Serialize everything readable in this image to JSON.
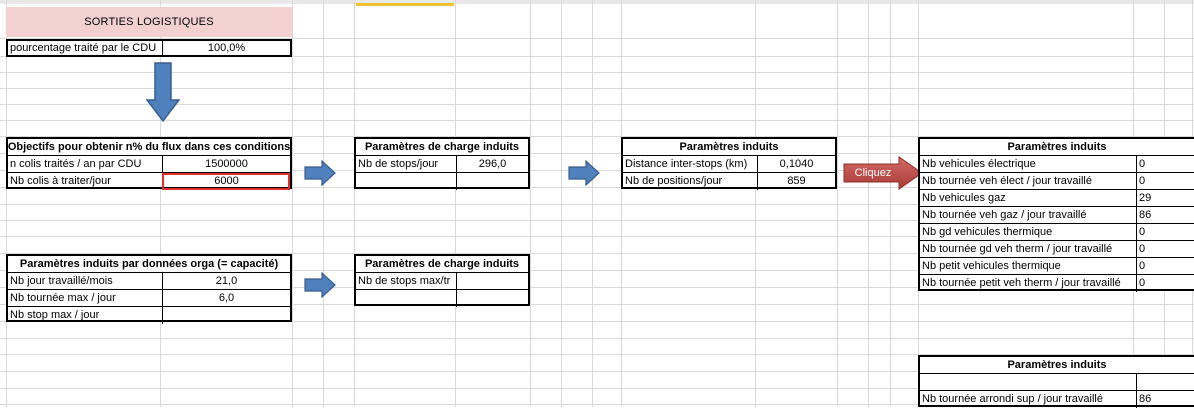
{
  "colors": {
    "title_fill": "#f3d1d1",
    "arrow_blue": "#4f81bd",
    "button_red": "#c0504d",
    "highlight_border": "#e03030"
  },
  "title": "SORTIES LOGISTIQUES",
  "percentage": {
    "label": "pourcentage traité par le CDU",
    "value": "100,0%"
  },
  "objectifs": {
    "header": "Objectifs pour obtenir n% du flux dans ces conditions",
    "rows": [
      {
        "label": "n colis traités / an par CDU",
        "value": "1500000"
      },
      {
        "label": "Nb colis à traiter/jour",
        "value": "6000"
      }
    ]
  },
  "orga": {
    "header": "Paramètres induits par données orga (= capacité)",
    "rows": [
      {
        "label": "Nb jour travaillé/mois",
        "value": "21,0"
      },
      {
        "label": "Nb tournée max / jour",
        "value": "6,0"
      },
      {
        "label": "Nb stop max / jour",
        "value": ""
      }
    ]
  },
  "charge1": {
    "header": "Paramètres de charge induits",
    "rows": [
      {
        "label": "Nb de stops/jour",
        "value": "296,0"
      },
      {
        "label": "",
        "value": ""
      }
    ]
  },
  "charge2": {
    "header": "Paramètres de charge induits",
    "rows": [
      {
        "label": "Nb de stops max/tr",
        "value": ""
      },
      {
        "label": "",
        "value": ""
      }
    ]
  },
  "induits_mid": {
    "header": "Paramètres induits",
    "rows": [
      {
        "label": "Distance inter-stops (km)",
        "value": "0,1040"
      },
      {
        "label": "Nb de positions/jour",
        "value": "859"
      }
    ]
  },
  "cliquez_label": "Cliquez",
  "induits_right": {
    "header": "Paramètres induits",
    "rows": [
      {
        "label": "Nb vehicules électrique",
        "value": "0"
      },
      {
        "label": "Nb tournée veh élect / jour travaillé",
        "value": "0"
      },
      {
        "label": "Nb vehicules gaz",
        "value": "29"
      },
      {
        "label": "Nb tournée veh gaz / jour travaillé",
        "value": "86"
      },
      {
        "label": "Nb gd vehicules thermique",
        "value": "0"
      },
      {
        "label": "Nb tournée gd veh therm / jour travaillé",
        "value": "0"
      },
      {
        "label": "Nb petit vehicules thermique",
        "value": "0"
      },
      {
        "label": "Nb tournée petit veh therm / jour travaillé",
        "value": "0"
      }
    ]
  },
  "induits_bottom": {
    "header": "Paramètres induits",
    "rows": [
      {
        "label": "",
        "value": ""
      },
      {
        "label": "Nb tournée arrondi sup / jour travaillé",
        "value": "86"
      }
    ]
  }
}
